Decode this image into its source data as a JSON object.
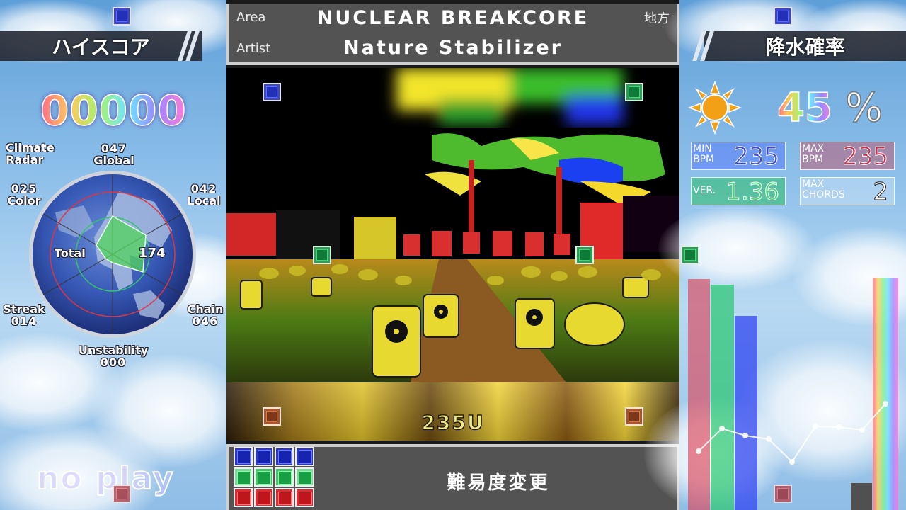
{
  "left_panel": {
    "title": "ハイスコア",
    "score": "00000",
    "radar": {
      "title_line1": "Climate",
      "title_line2": "Radar",
      "global": {
        "value": "047",
        "label": "Global"
      },
      "local": {
        "value": "042",
        "label": "Local"
      },
      "color": {
        "value": "025",
        "label": "Color"
      },
      "chain": {
        "value": "046",
        "label": "Chain"
      },
      "streak": {
        "value": "014",
        "label": "Streak"
      },
      "unstability": {
        "value": "000",
        "label": "Unstability"
      },
      "total_label": "Total",
      "total_value": "174"
    },
    "status": "no play"
  },
  "song": {
    "area_label": "Area",
    "area_label_jp": "地方",
    "artist_label": "Artist",
    "title": "NUCLEAR BREAKCORE",
    "artist": "Nature Stabilizer",
    "level": "235U"
  },
  "difficulty": {
    "change_label": "難易度変更",
    "rows": [
      [
        "blue",
        "blue",
        "blue",
        "blue"
      ],
      [
        "green-dim",
        "green",
        "green",
        "green-dim"
      ],
      [
        "red",
        "red",
        "red",
        "red"
      ]
    ]
  },
  "right_panel": {
    "title": "降水確率",
    "weather_icon": "sun-icon",
    "rain_value": "45",
    "rain_unit": "%",
    "min_bpm_label_1": "MIN",
    "min_bpm_label_2": "BPM",
    "min_bpm": "235",
    "max_bpm_label_1": "MAX",
    "max_bpm_label_2": "BPM",
    "max_bpm": "235",
    "ver_label": "VER.",
    "ver": "1.36",
    "max_chords_label_1": "MAX",
    "max_chords_label_2": "CHORDS",
    "max_chords": "2"
  },
  "colors": {
    "blue": "#2a36c6",
    "green": "#16a043",
    "red": "#e12a30",
    "panel": "#535353"
  }
}
